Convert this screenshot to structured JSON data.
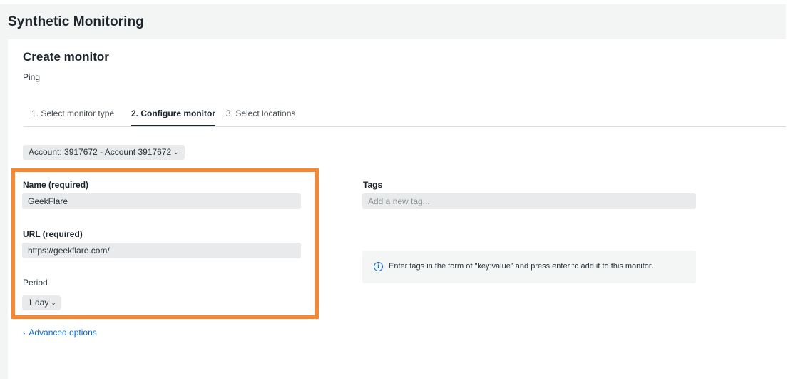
{
  "app": {
    "title": "Synthetic Monitoring"
  },
  "page": {
    "heading": "Create monitor",
    "subheading": "Ping"
  },
  "tabs": [
    {
      "label": "1. Select monitor type",
      "active": false
    },
    {
      "label": "2. Configure monitor",
      "active": true
    },
    {
      "label": "3. Select locations",
      "active": false
    }
  ],
  "account_select": {
    "value": "Account: 3917672 - Account 3917672"
  },
  "form": {
    "name": {
      "label": "Name (required)",
      "value": "GeekFlare"
    },
    "url": {
      "label": "URL (required)",
      "value": "https://geekflare.com/"
    },
    "period": {
      "label": "Period",
      "value": "1 day"
    },
    "tags": {
      "label": "Tags",
      "placeholder": "Add a new tag..."
    },
    "advanced_label": "Advanced options"
  },
  "info": {
    "icon": "info-icon",
    "text": "Enter tags in the form of \"key:value\" and press enter to add it to this monitor."
  },
  "colors": {
    "highlight": "#f7882f",
    "link": "#0b6acb",
    "input_bg": "#e8eaeb",
    "header_bg": "#f3f4f4"
  }
}
